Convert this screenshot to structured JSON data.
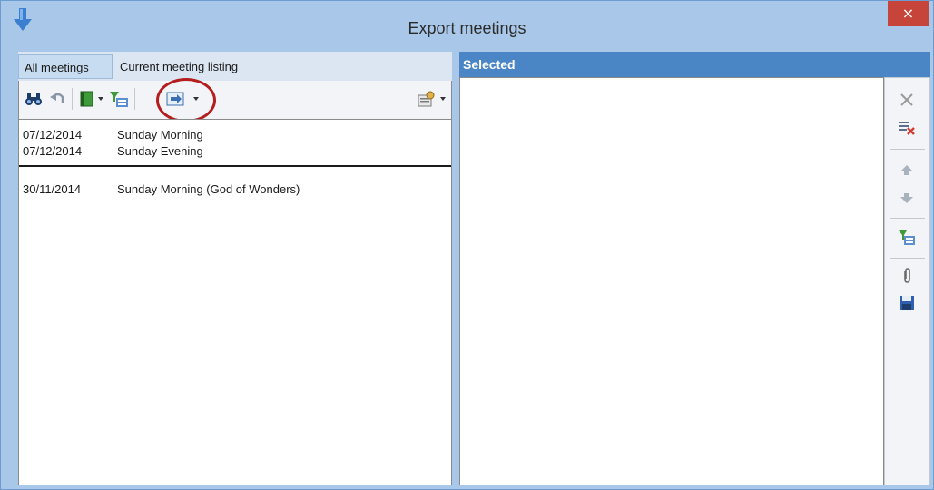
{
  "window": {
    "title": "Export meetings",
    "close_label": "×"
  },
  "tabs": [
    {
      "label": "All meetings",
      "active": true
    },
    {
      "label": "Current meeting listing",
      "active": false
    }
  ],
  "toolbar": {
    "icons": [
      "binoculars-icon",
      "undo-icon",
      "book-icon",
      "filter-icon",
      "export-icon",
      "properties-icon"
    ]
  },
  "meetings": [
    {
      "date": "07/12/2014",
      "name": "Sunday Morning"
    },
    {
      "date": "07/12/2014",
      "name": "Sunday Evening"
    },
    {
      "date": "30/11/2014",
      "name": "Sunday Morning (God of Wonders)"
    }
  ],
  "selected_panel": {
    "header": "Selected"
  },
  "side_toolbar": {
    "icons": [
      "clear-icon",
      "remove-icon",
      "move-up-icon",
      "move-down-icon",
      "add-filter-icon",
      "attach-icon",
      "save-icon"
    ]
  },
  "colors": {
    "title_bar": "#a9c7e8",
    "close_button": "#c7443b",
    "selected_header": "#4a86c5",
    "highlight_circle": "#b41e1e"
  }
}
